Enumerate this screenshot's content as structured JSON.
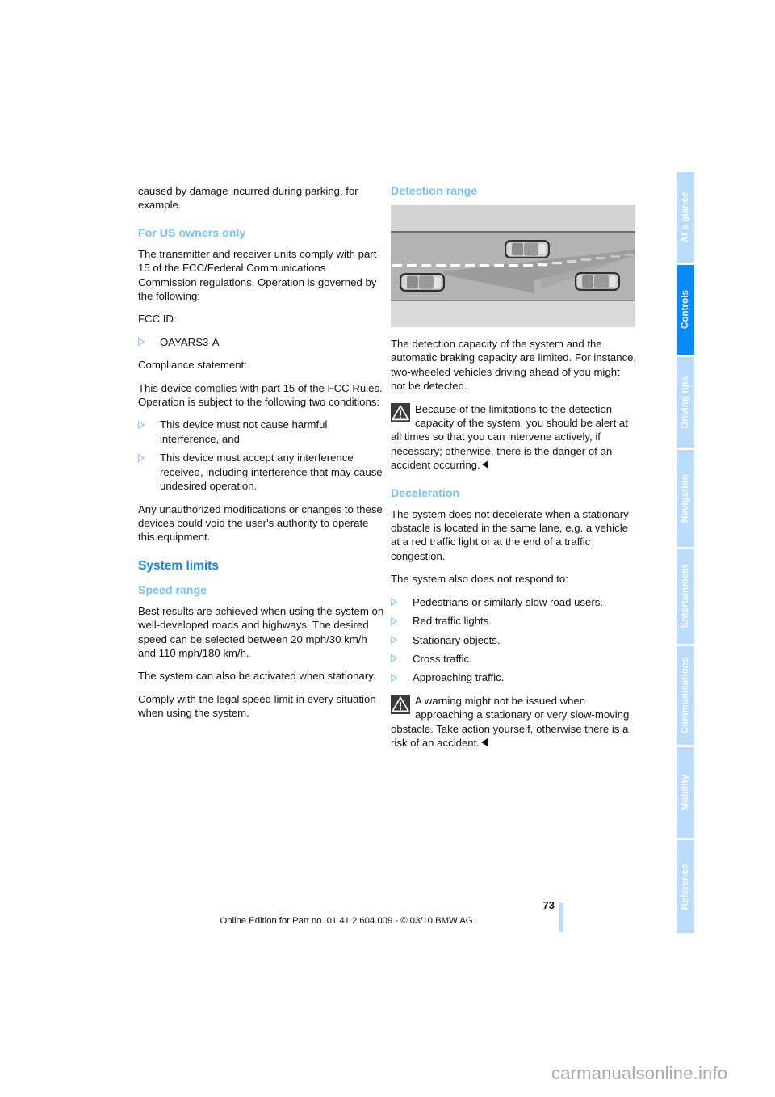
{
  "document": {
    "page_number": "73",
    "imprint": "Online Edition for Part no. 01 41 2 604 009 - © 03/10 BMW AG",
    "watermark": "carmanualsonline.info"
  },
  "sidebar": {
    "tabs": [
      {
        "label": "At a glance",
        "active": false
      },
      {
        "label": "Controls",
        "active": true
      },
      {
        "label": "Driving tips",
        "active": false
      },
      {
        "label": "Navigation",
        "active": false
      },
      {
        "label": "Entertainment",
        "active": false
      },
      {
        "label": "Communications",
        "active": false
      },
      {
        "label": "Mobility",
        "active": false
      },
      {
        "label": "Reference",
        "active": false
      }
    ],
    "active_color": "#0a8aff",
    "inactive_color": "#badcfa"
  },
  "left_column": {
    "intro": "caused by damage incurred during parking, for example.",
    "us_owners_heading": "For US owners only",
    "us_owners_p1": "The transmitter and receiver units comply with part 15 of the FCC/Federal Communications Commission regulations. Operation is governed by the following:",
    "fcc_id_label": "FCC ID:",
    "fcc_id_value": "OAYARS3-A",
    "compliance_label": "Compliance statement:",
    "compliance_p": "This device complies with part 15 of the FCC Rules. Operation is subject to the following two conditions:",
    "conditions": [
      "This device must not cause harmful interference, and",
      "This device must accept any interference received, including interference that may cause undesired operation."
    ],
    "unauthorized_p": "Any unauthorized modifications or changes to these devices could void the user's authority to operate this equipment.",
    "system_limits_heading": "System limits",
    "speed_range_heading": "Speed range",
    "speed_p1": "Best results are achieved when using the system on well-developed roads and highways. The desired speed can be selected between 20 mph/30 km/h and 110 mph/180 km/h.",
    "speed_p2": "The system can also be activated when stationary.",
    "speed_p3": "Comply with the legal speed limit in every situation when using the system."
  },
  "right_column": {
    "detection_heading": "Detection range",
    "figure": {
      "name": "detection-range-diagram",
      "road_color": "#b0b0b0",
      "shoulder_color": "#d0d0d0",
      "cone_color": "#9a9a9a",
      "lane_marking_color": "#ffffff",
      "vehicle_count": 3
    },
    "detection_p": "The detection capacity of the system and the automatic braking capacity are limited. For instance, two-wheeled vehicles driving ahead of you might not be detected.",
    "warning_1": "Because of the limitations to the detection capacity of the system, you should be alert at all times so that you can intervene actively, if necessary; otherwise, there is the danger of an accident occurring.",
    "deceleration_heading": "Deceleration",
    "decel_p1": "The system does not decelerate when a stationary obstacle is located in the same lane, e.g. a vehicle at a red traffic light or at the end of a traffic congestion.",
    "decel_p2": "The system also does not respond to:",
    "no_response_items": [
      "Pedestrians or similarly slow road users.",
      "Red traffic lights.",
      "Stationary objects.",
      "Cross traffic.",
      "Approaching traffic."
    ],
    "warning_2": "A warning might not be issued when approaching a stationary or very slow-moving obstacle. Take action yourself, otherwise there is a risk of an accident."
  }
}
